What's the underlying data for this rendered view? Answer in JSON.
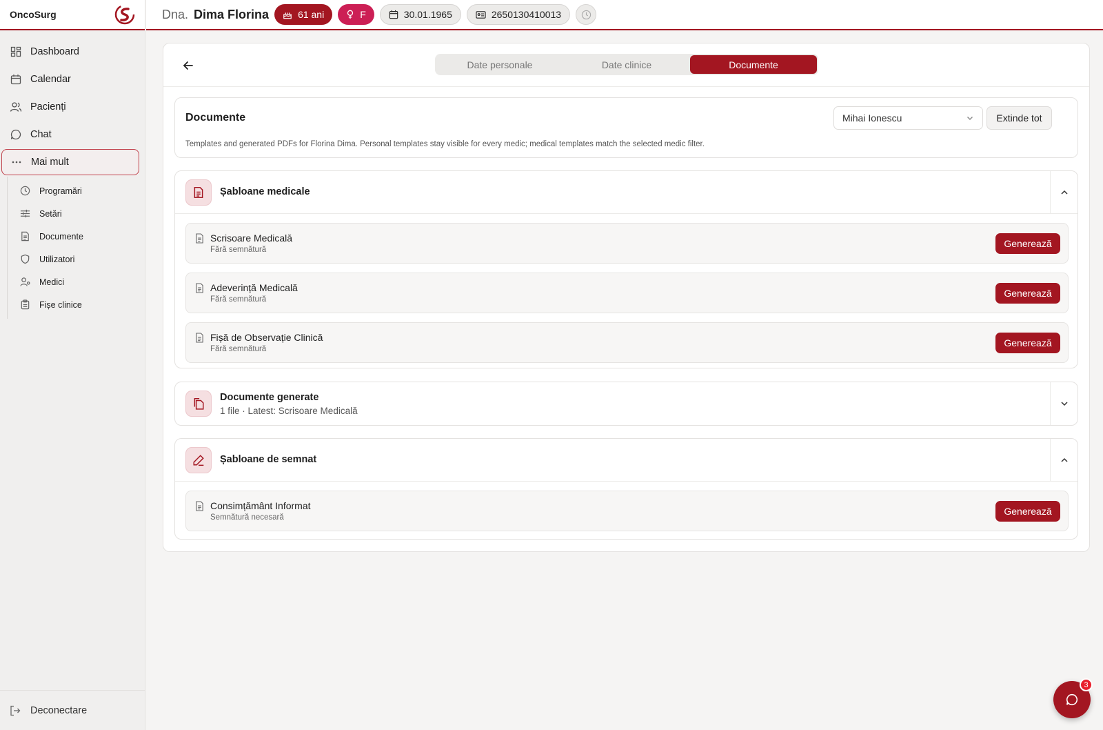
{
  "app": {
    "name": "OncoSurg"
  },
  "sidebar": {
    "items": [
      {
        "label": "Dashboard",
        "icon": "dashboard-icon"
      },
      {
        "label": "Calendar",
        "icon": "calendar-icon"
      },
      {
        "label": "Pacienți",
        "icon": "users-icon"
      },
      {
        "label": "Chat",
        "icon": "chat-icon"
      },
      {
        "label": "Mai mult",
        "icon": "more-icon",
        "active": true
      }
    ],
    "sub_items": [
      {
        "label": "Programări",
        "icon": "clock-icon"
      },
      {
        "label": "Setări",
        "icon": "sliders-icon"
      },
      {
        "label": "Documente",
        "icon": "document-icon"
      },
      {
        "label": "Utilizatori",
        "icon": "shield-icon"
      },
      {
        "label": "Medici",
        "icon": "doctor-icon"
      },
      {
        "label": "Fișe clinice",
        "icon": "clipboard-icon"
      }
    ],
    "logout_label": "Deconectare"
  },
  "patient": {
    "prefix": "Dna.",
    "name": "Dima Florina",
    "age": "61 ani",
    "sex": "F",
    "birth_date": "30.01.1965",
    "cnp": "2650130410013"
  },
  "tabs": [
    {
      "label": "Date personale"
    },
    {
      "label": "Date clinice"
    },
    {
      "label": "Documente",
      "active": true
    }
  ],
  "documents": {
    "title": "Documente",
    "description": "Templates and generated PDFs for Florina Dima. Personal templates stay visible for every medic; medical templates match the selected medic filter.",
    "medic_filter": "Mihai Ionescu",
    "expand_label": "Extinde tot"
  },
  "sections": {
    "medical": {
      "title": "Șabloane medicale",
      "items": [
        {
          "name": "Scrisoare Medicală",
          "meta": "Fără semnătură",
          "action": "Generează"
        },
        {
          "name": "Adeverință Medicală",
          "meta": "Fără semnătură",
          "action": "Generează"
        },
        {
          "name": "Fișă de Observație Clinică",
          "meta": "Fără semnătură",
          "action": "Generează"
        }
      ]
    },
    "generated": {
      "title": "Documente generate",
      "subtitle": "1 file · Latest: Scrisoare Medicală"
    },
    "signing": {
      "title": "Șabloane de semnat",
      "items": [
        {
          "name": "Consimțământ Informat",
          "meta": "Semnătură necesară",
          "action": "Generează"
        }
      ]
    }
  },
  "chat_fab": {
    "badge": "3"
  },
  "colors": {
    "accent": "#a31621",
    "pink": "#cc1f55"
  }
}
